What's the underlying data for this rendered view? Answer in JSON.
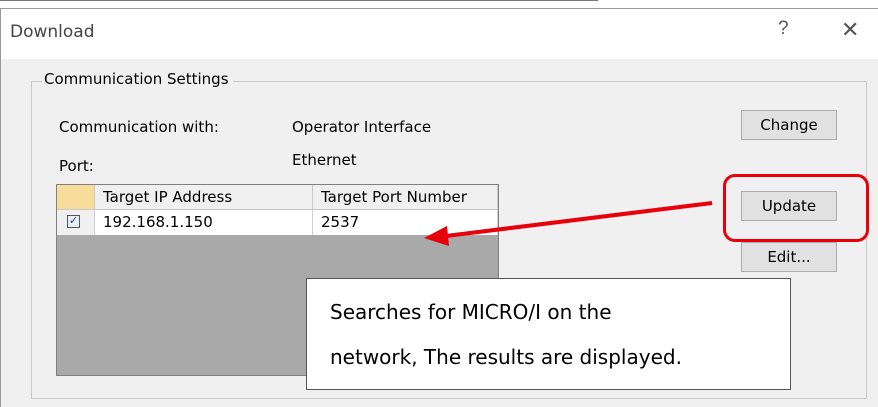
{
  "window": {
    "title": "Download",
    "help_icon": "?",
    "close_icon": "✕"
  },
  "group": {
    "label": "Communication Settings",
    "communication_label": "Communication with:",
    "communication_value": "Operator Interface",
    "port_label": "Port:",
    "port_value": "Ethernet"
  },
  "buttons": {
    "change": "Change",
    "update": "Update",
    "edit": "Edit..."
  },
  "table": {
    "columns": [
      "Target IP Address",
      "Target Port Number"
    ],
    "rows": [
      {
        "checked": true,
        "ip": "192.168.1.150",
        "port": "2537"
      }
    ]
  },
  "callout": {
    "line1": "Searches for MICRO/I on the",
    "line2": "network, The results are displayed."
  },
  "colors": {
    "highlight": "#e8000b",
    "dialog_bg": "#f0f0f0"
  }
}
